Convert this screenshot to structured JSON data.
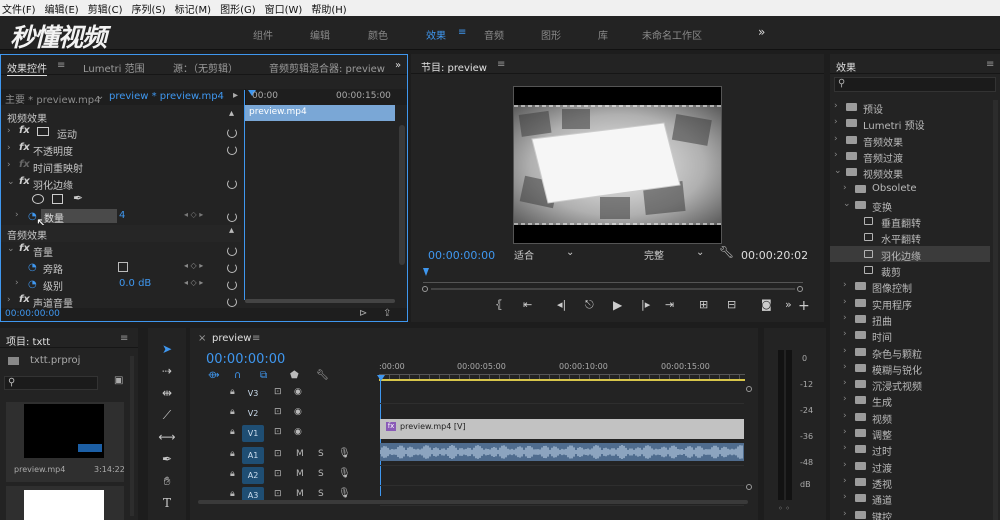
{
  "menubar": {
    "items": [
      "文件(F)",
      "编辑(E)",
      "剪辑(C)",
      "序列(S)",
      "标记(M)",
      "图形(G)",
      "窗口(W)",
      "帮助(H)"
    ]
  },
  "logo": {
    "text": "秒懂视频"
  },
  "workspaces": {
    "items": [
      "组件",
      "编辑",
      "颜色",
      "效果",
      "音频",
      "图形",
      "库",
      "未命名工作区"
    ],
    "active": "效果",
    "more": "»"
  },
  "effect_controls": {
    "tabs": [
      "效果控件",
      "Lumetri 范围",
      "源：（无剪辑）",
      "音频剪辑混合器: preview"
    ],
    "master_label": "主要 * preview.mp4",
    "sequence_label": "preview * preview.mp4",
    "ruler_start": "00:00",
    "ruler_end": "00:00:15:00",
    "clip_label": "preview.mp4",
    "video_section": "视频效果",
    "audio_section": "音频效果",
    "motion": "运动",
    "opacity": "不透明度",
    "time_remap": "时间重映射",
    "feather": "羽化边缘",
    "amount": "数量",
    "amount_value": "4",
    "volume": "音量",
    "bypass": "旁路",
    "level": "级别",
    "level_value": "0.0 dB",
    "channel_volume": "声道音量",
    "timecode": "00:00:00:00"
  },
  "program": {
    "title": "节目: preview",
    "timecode_left": "00:00:00:00",
    "fit": "适合",
    "quality": "完整",
    "timecode_right": "00:00:20:02"
  },
  "effects_panel": {
    "title": "效果",
    "search_placeholder": "",
    "tree": [
      {
        "label": "预设",
        "level": 0,
        "icon": "folder-star"
      },
      {
        "label": "Lumetri 预设",
        "level": 0,
        "icon": "folder-star"
      },
      {
        "label": "音频效果",
        "level": 0,
        "icon": "folder"
      },
      {
        "label": "音频过渡",
        "level": 0,
        "icon": "folder"
      },
      {
        "label": "视频效果",
        "level": 0,
        "icon": "folder",
        "open": true
      },
      {
        "label": "Obsolete",
        "level": 1,
        "icon": "folder"
      },
      {
        "label": "变换",
        "level": 1,
        "icon": "folder",
        "open": true
      },
      {
        "label": "垂直翻转",
        "level": 2,
        "icon": "effect"
      },
      {
        "label": "水平翻转",
        "level": 2,
        "icon": "effect"
      },
      {
        "label": "羽化边缘",
        "level": 2,
        "icon": "effect",
        "selected": true
      },
      {
        "label": "裁剪",
        "level": 2,
        "icon": "effect"
      },
      {
        "label": "图像控制",
        "level": 1,
        "icon": "folder"
      },
      {
        "label": "实用程序",
        "level": 1,
        "icon": "folder"
      },
      {
        "label": "扭曲",
        "level": 1,
        "icon": "folder"
      },
      {
        "label": "时间",
        "level": 1,
        "icon": "folder"
      },
      {
        "label": "杂色与颗粒",
        "level": 1,
        "icon": "folder"
      },
      {
        "label": "模糊与锐化",
        "level": 1,
        "icon": "folder"
      },
      {
        "label": "沉浸式视频",
        "level": 1,
        "icon": "folder"
      },
      {
        "label": "生成",
        "level": 1,
        "icon": "folder"
      },
      {
        "label": "视频",
        "level": 1,
        "icon": "folder"
      },
      {
        "label": "调整",
        "level": 1,
        "icon": "folder"
      },
      {
        "label": "过时",
        "level": 1,
        "icon": "folder"
      },
      {
        "label": "过渡",
        "level": 1,
        "icon": "folder"
      },
      {
        "label": "透视",
        "level": 1,
        "icon": "folder"
      },
      {
        "label": "通道",
        "level": 1,
        "icon": "folder"
      },
      {
        "label": "键控",
        "level": 1,
        "icon": "folder"
      }
    ]
  },
  "project": {
    "title": "项目: txtt",
    "file": "txtt.prproj",
    "clip_name": "preview.mp4",
    "clip_duration": "3:14:22"
  },
  "timeline": {
    "tab": "preview",
    "timecode": "00:00:00:00",
    "ruler": [
      ":00:00",
      "00:00:05:00",
      "00:00:10:00",
      "00:00:15:00"
    ],
    "tracks": [
      {
        "name": "V3",
        "btn": ""
      },
      {
        "name": "V2",
        "btn": ""
      },
      {
        "name": "V1",
        "btn": "V1"
      },
      {
        "name": "A1",
        "btn": "A1"
      },
      {
        "name": "A2",
        "btn": "A2"
      },
      {
        "name": "A3",
        "btn": "A3"
      }
    ],
    "video_clip": "preview.mp4 [V]",
    "m_label": "M",
    "s_label": "S"
  },
  "meter": {
    "labels": [
      "0",
      "-12",
      "-24",
      "-36",
      "-48",
      "dB"
    ]
  },
  "colors": {
    "accent": "#3f97ef",
    "panel": "#232323",
    "bg": "#1d1d1d",
    "playhead": "#3f97ef",
    "clip": "#bdbdbd",
    "audio_clip": "#4f6c8e"
  }
}
